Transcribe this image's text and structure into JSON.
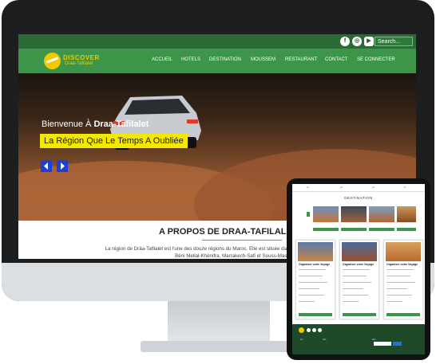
{
  "site": {
    "logo_line1": "DISCOVER",
    "logo_line2": "Draa-Tafilalet"
  },
  "topbar": {
    "social_icons": [
      "facebook-icon",
      "instagram-icon",
      "youtube-icon"
    ],
    "search_placeholder": "Search..."
  },
  "nav": {
    "items": [
      "ACCUEIL",
      "HOTELS",
      "DESTINATION",
      "MOUSSEM",
      "RESTAURANT",
      "CONTACT",
      "SE CONNECTER"
    ]
  },
  "hero": {
    "welcome_prefix": "Bienvenue À ",
    "welcome_name": "Draa-Tafilalet",
    "tagline": "La Région Que Le Temps A Oubliée",
    "prev_icon": "chevron-left-icon",
    "next_icon": "chevron-right-icon"
  },
  "about": {
    "title": "A PROPOS DE DRAA-TAFILALET",
    "text_line1": "La région de Drâa-Tafilalet est l'une des douze régions du Maroc. Elle est située dans le sud-est du pays et",
    "text_line2": "Béni Mellal-Khénifra, Marrakech-Safi et Souss-Massa. La région est également bordée"
  },
  "tablet": {
    "heading": "DESTINATION",
    "cards": [
      "Organiser votre Voyage",
      "Organiser votre Voyage",
      "Organiser votre Voyage"
    ]
  },
  "colors": {
    "topbar": "#2a6b35",
    "nav": "#3c9548",
    "tagline_bg": "#f5e800",
    "slider_button": "#1e3fd6",
    "logo": "#f2c900"
  }
}
